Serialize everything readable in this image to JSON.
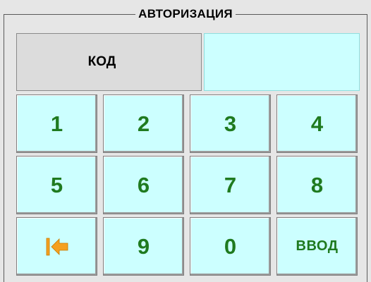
{
  "dialog": {
    "title": "АВТОРИЗАЦИЯ"
  },
  "code": {
    "label": "КОД",
    "value": ""
  },
  "keypad": {
    "key_1": "1",
    "key_2": "2",
    "key_3": "3",
    "key_4": "4",
    "key_5": "5",
    "key_6": "6",
    "key_7": "7",
    "key_8": "8",
    "key_9": "9",
    "key_0": "0",
    "enter_label": "ВВОД",
    "backspace_icon": "arrow-left-to-bar-icon"
  },
  "colors": {
    "key_background": "#ccffff",
    "key_text": "#1f7a1f",
    "backspace_icon": "#f5a020"
  }
}
